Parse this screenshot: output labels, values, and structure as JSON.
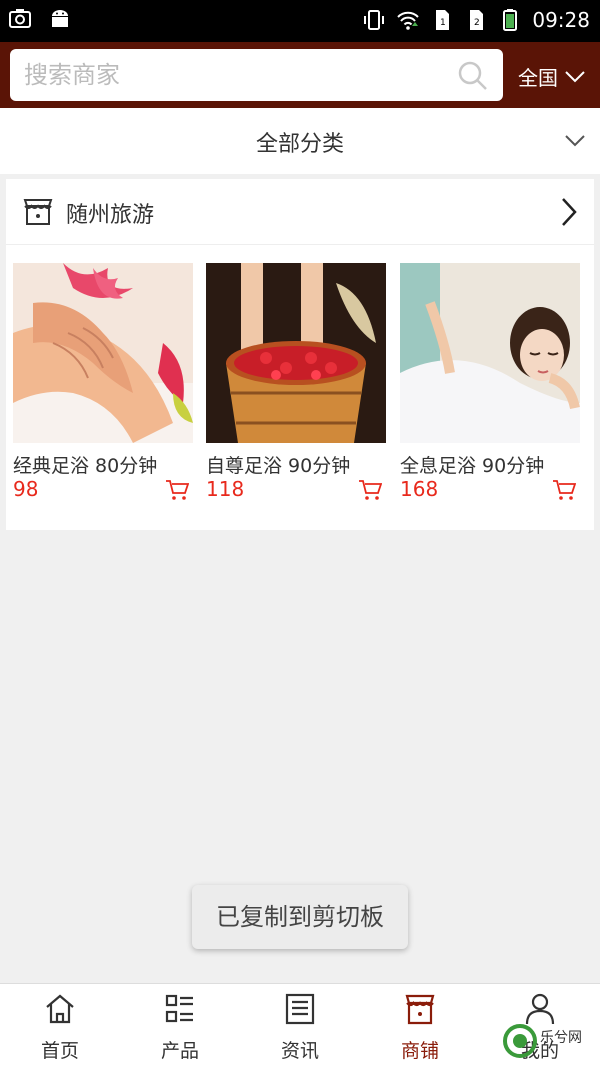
{
  "status_bar": {
    "time": "09:28",
    "icons": [
      "screenshot-icon",
      "android-icon",
      "vibrate-icon",
      "wifi-icon",
      "sim1-icon",
      "sim2-icon",
      "battery-icon"
    ]
  },
  "header": {
    "search_placeholder": "搜索商家",
    "region_label": "全国",
    "background_color": "#5a1406"
  },
  "category_bar": {
    "title": "全部分类"
  },
  "shop": {
    "name": "随州旅游",
    "products": [
      {
        "name": "经典足浴 80分钟",
        "price": "98"
      },
      {
        "name": "自尊足浴 90分钟",
        "price": "118"
      },
      {
        "name": "全息足浴 90分钟",
        "price": "168"
      }
    ]
  },
  "toast": {
    "message": "已复制到剪切板"
  },
  "bottom_nav": {
    "items": [
      {
        "label": "首页",
        "icon": "home-icon"
      },
      {
        "label": "产品",
        "icon": "list-icon"
      },
      {
        "label": "资讯",
        "icon": "news-icon"
      },
      {
        "label": "商铺",
        "icon": "store-icon",
        "active": true
      },
      {
        "label": "我的",
        "icon": "user-icon"
      }
    ],
    "active_color": "#8a1c0a"
  },
  "watermark": {
    "text": "乐兮网"
  },
  "colors": {
    "price": "#e8291c",
    "accent": "#8a1c0a"
  }
}
